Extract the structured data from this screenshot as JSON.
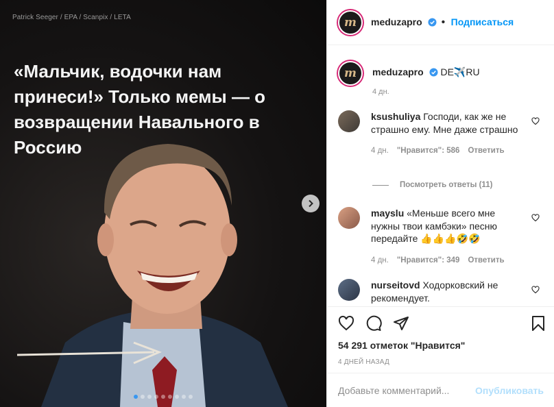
{
  "media": {
    "credit": "Patrick Seeger / EPA / Scanpix / LETA",
    "headline": "«Мальчик, водочки нам принеси!» Только мемы — о возвращении Навального в Россию",
    "carousel": {
      "slides": 9,
      "active": 1
    }
  },
  "header": {
    "avatar_letter": "m",
    "username": "meduzapro",
    "separator": "•",
    "follow_label": "Подписаться"
  },
  "caption": {
    "avatar_letter": "m",
    "username": "meduzapro",
    "text": "DE✈️RU",
    "time": "4 дн."
  },
  "comments": [
    {
      "username": "ksushuliya",
      "text": "Господи, как же не страшно ему. Мне даже страшно",
      "time": "4 дн.",
      "likes": "\"Нравится\": 586",
      "reply_label": "Ответить"
    },
    {
      "username": "mayslu",
      "text": "«Меньше всего мне нужны твои камбэки» песню передайте 👍👍👍🤣🤣",
      "time": "4 дн.",
      "likes": "\"Нравится\": 349",
      "reply_label": "Ответить"
    },
    {
      "username": "nurseitovd",
      "text": "Ходорковский не рекомендует."
    }
  ],
  "view_replies": "Посмотреть ответы (11)",
  "likes_count": "54 291 отметок \"Нравится\"",
  "posted": "4 ДНЕЙ НАЗАД",
  "add_comment": {
    "placeholder": "Добавьте комментарий...",
    "publish_label": "Опубликовать"
  },
  "colors": {
    "accent": "#0095f6",
    "publish_disabled": "#b2dffc",
    "muted": "#8e8e8e",
    "carousel_active": "#3897f0"
  },
  "icons": [
    "chevron-right-icon",
    "verified-badge-icon",
    "heart-icon",
    "comment-icon",
    "share-icon",
    "bookmark-icon"
  ]
}
